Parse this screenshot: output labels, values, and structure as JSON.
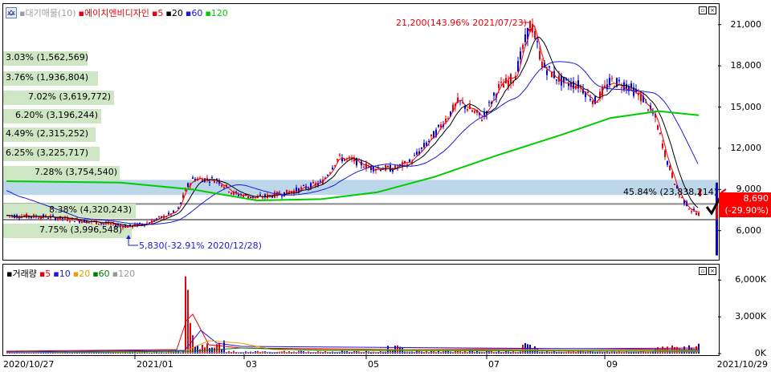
{
  "price_pane": {
    "legend": {
      "prefix": "▪대기매물(10)",
      "name": "▪에이치엔비디자인",
      "ma5": "▪5",
      "ma20": "▪20",
      "ma60": "▪60",
      "ma120": "▪120"
    },
    "high_annotation": "21,200(143.96% 2021/07/23)",
    "low_annotation": "5,830(-32.91% 2020/12/28)",
    "current_price": "8,690",
    "current_change": "(-29.90%)",
    "band_label": "45.84% (23,838,214)",
    "band_labels_left": [
      "3.03% (1,562,569)",
      "3.76% (1,936,804)",
      "7.02% (3,619,772)",
      "6.20% (3,196,244)",
      "4.49% (2,315,252)",
      "6.25% (3,225,717)",
      "7.28% (3,754,540)",
      "8.38% (4,320,243)",
      "7.75% (3,996,548)"
    ],
    "y_ticks": [
      "21,000",
      "18,000",
      "15,000",
      "12,000",
      "9,000",
      "6,000"
    ],
    "volume_profile_pct": [
      3.03,
      3.76,
      7.02,
      6.2,
      4.49,
      6.25,
      7.28,
      45.84,
      8.38,
      7.75
    ]
  },
  "volume_pane": {
    "legend": {
      "name": "▪거래량",
      "ma5": "▪5",
      "ma10": "▪10",
      "ma20": "▪20",
      "ma60": "▪60",
      "ma120": "▪120"
    },
    "y_ticks": [
      "6,000K",
      "3,000K",
      "0K"
    ]
  },
  "x_axis": [
    "2020/10/27",
    "2021/01",
    "03",
    "05",
    "07",
    "09",
    "2021/10/29"
  ],
  "colors": {
    "up": "#e8000b",
    "down": "#0000d8",
    "ma5": "#e8000b",
    "ma20": "#000000",
    "ma60": "#1a1ad8",
    "ma120": "#00cc00",
    "band": "#bcd6ea",
    "left_band": "#cfe6c4"
  },
  "chart_data": {
    "type": "candlestick",
    "x_range": [
      "2020/10/27",
      "2021/10/29"
    ],
    "ylim": [
      4000,
      22500
    ],
    "price_points": [
      {
        "date": "2020/10/27",
        "close": 7100
      },
      {
        "date": "2020/12/28",
        "low": 5830
      },
      {
        "date": "2021/01",
        "close": 7300
      },
      {
        "date": "2021/02",
        "close": 9200
      },
      {
        "date": "2021/03",
        "close": 8500
      },
      {
        "date": "2021/04",
        "close": 11200
      },
      {
        "date": "2021/05",
        "close": 11000
      },
      {
        "date": "2021/06",
        "close": 15300
      },
      {
        "date": "2021/07/23",
        "high": 21200
      },
      {
        "date": "2021/08",
        "close": 16500
      },
      {
        "date": "2021/09",
        "close": 16700
      },
      {
        "date": "2021/10/29",
        "close": 8690
      }
    ]
  }
}
